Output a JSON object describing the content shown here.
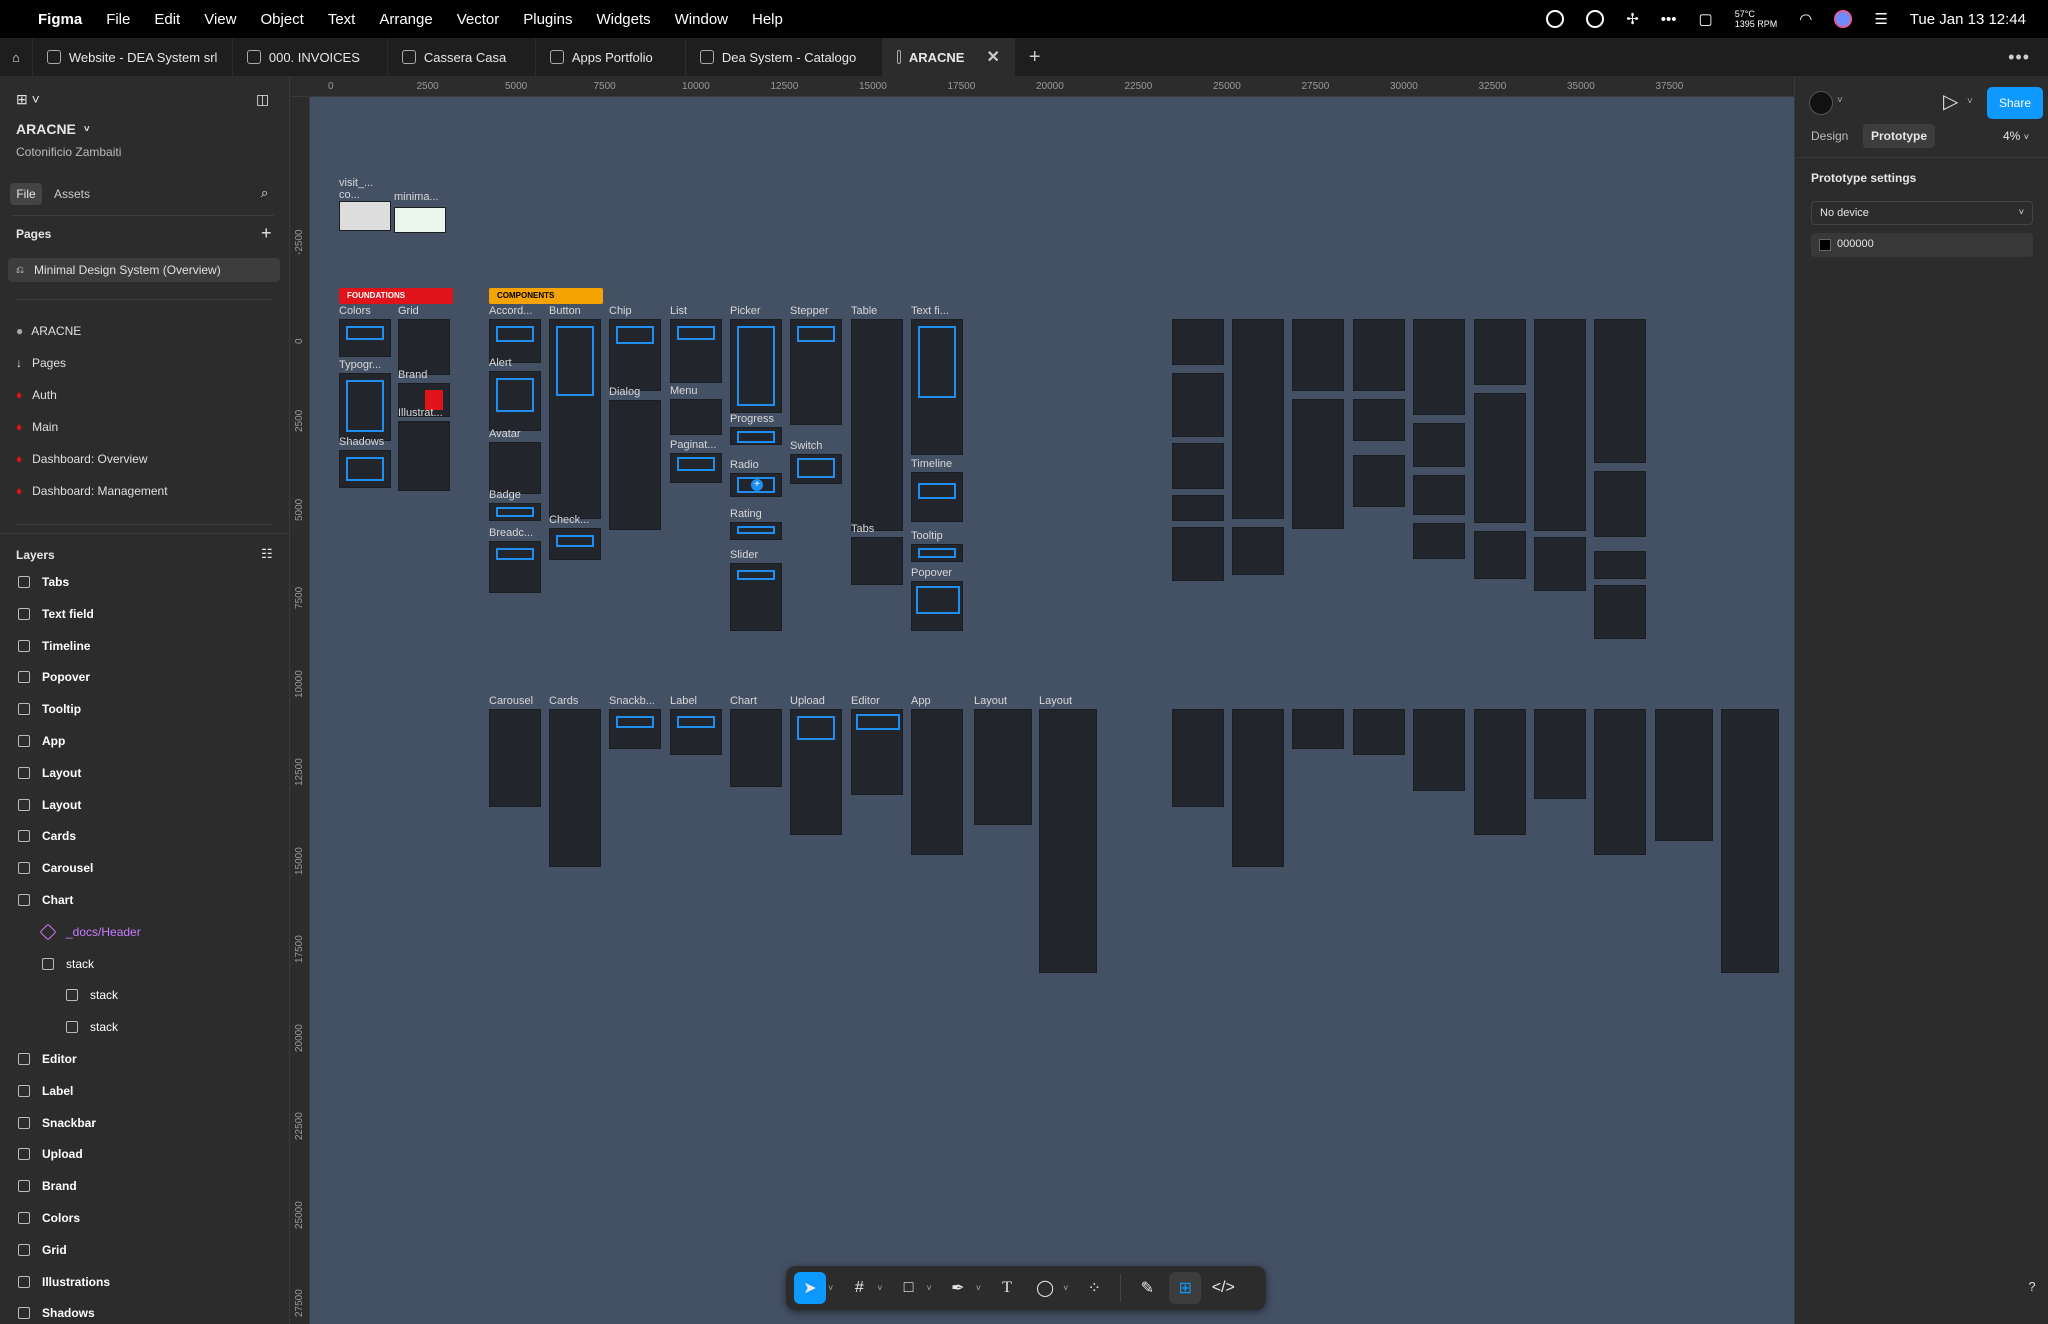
{
  "menubar": {
    "app": "Figma",
    "items": [
      "File",
      "Edit",
      "View",
      "Object",
      "Text",
      "Arrange",
      "Vector",
      "Plugins",
      "Widgets",
      "Window",
      "Help"
    ],
    "temp": "57°C",
    "rpm": "1395 RPM",
    "datetime": "Tue Jan 13  12:44"
  },
  "tabs": [
    {
      "label": "Website - DEA System srl",
      "active": false
    },
    {
      "label": "000. INVOICES",
      "active": false
    },
    {
      "label": "Cassera Casa",
      "active": false
    },
    {
      "label": "Apps Portfolio",
      "active": false
    },
    {
      "label": "Dea System - Catalogo",
      "active": false
    },
    {
      "label": "ARACNE",
      "active": true
    }
  ],
  "left": {
    "file_name": "ARACNE",
    "team": "Cotonificio Zambaiti",
    "tab_file": "File",
    "tab_assets": "Assets",
    "pages_title": "Pages",
    "pages": [
      {
        "label": "Minimal Design System (Overview)",
        "selected": true
      },
      {
        "label": "ARACNE"
      },
      {
        "label": "Pages"
      },
      {
        "label": "Auth"
      },
      {
        "label": "Main"
      },
      {
        "label": "Dashboard: Overview"
      },
      {
        "label": "Dashboard: Management"
      }
    ],
    "layers_title": "Layers",
    "layers": [
      {
        "label": "Tabs",
        "indent": 0
      },
      {
        "label": "Text field",
        "indent": 0
      },
      {
        "label": "Timeline",
        "indent": 0
      },
      {
        "label": "Popover",
        "indent": 0
      },
      {
        "label": "Tooltip",
        "indent": 0
      },
      {
        "label": "App",
        "indent": 0
      },
      {
        "label": "Layout",
        "indent": 0
      },
      {
        "label": "Layout",
        "indent": 0
      },
      {
        "label": "Cards",
        "indent": 0
      },
      {
        "label": "Carousel",
        "indent": 0
      },
      {
        "label": "Chart",
        "indent": 0
      },
      {
        "label": "_docs/Header",
        "indent": 1,
        "component": true
      },
      {
        "label": "stack",
        "indent": 1
      },
      {
        "label": "stack",
        "indent": 2
      },
      {
        "label": "stack",
        "indent": 2
      },
      {
        "label": "Editor",
        "indent": 0
      },
      {
        "label": "Label",
        "indent": 0
      },
      {
        "label": "Snackbar",
        "indent": 0
      },
      {
        "label": "Upload",
        "indent": 0
      },
      {
        "label": "Brand",
        "indent": 0
      },
      {
        "label": "Colors",
        "indent": 0
      },
      {
        "label": "Grid",
        "indent": 0
      },
      {
        "label": "Illustrations",
        "indent": 0
      },
      {
        "label": "Shadows",
        "indent": 0
      }
    ]
  },
  "ruler": {
    "top": [
      "0",
      "2500",
      "5000",
      "7500",
      "10000",
      "12500",
      "15000",
      "17500",
      "20000",
      "22500",
      "25000",
      "27500",
      "30000",
      "32500",
      "35000",
      "37500"
    ],
    "left": [
      "-2500",
      "0",
      "2500",
      "5000",
      "7500",
      "10000",
      "12500",
      "15000",
      "17500",
      "20000",
      "22500",
      "25000",
      "27500"
    ]
  },
  "canvas": {
    "foundations_tag": "FOUNDATIONS",
    "components_tag": "COMPONENTS",
    "labels": {
      "visit": "visit_...",
      "co": "co...",
      "minima": "minima...",
      "colors": "Colors",
      "grid": "Grid",
      "typogr": "Typogr...",
      "brand": "Brand",
      "illustrat": "Illustrat...",
      "shadows": "Shadows",
      "accord": "Accord...",
      "button": "Button",
      "chip": "Chip",
      "list": "List",
      "picker": "Picker",
      "stepper": "Stepper",
      "table": "Table",
      "textfi": "Text fi...",
      "alert": "Alert",
      "dialog": "Dialog",
      "menu": "Menu",
      "progress": "Progress",
      "switch": "Switch",
      "avatar": "Avatar",
      "paginat": "Paginat...",
      "radio": "Radio",
      "timeline": "Timeline",
      "badge": "Badge",
      "rating": "Rating",
      "breadc": "Breadc...",
      "check": "Check...",
      "tabs": "Tabs",
      "tooltip": "Tooltip",
      "slider": "Slider",
      "popover": "Popover",
      "carousel": "Carousel",
      "cards": "Cards",
      "snackb": "Snackb...",
      "label": "Label",
      "chart": "Chart",
      "upload": "Upload",
      "editor": "Editor",
      "app": "App",
      "layout1": "Layout",
      "layout2": "Layout"
    }
  },
  "right": {
    "share": "Share",
    "tab_design": "Design",
    "tab_prototype": "Prototype",
    "zoom": "4%",
    "section_title": "Prototype settings",
    "device": "No device",
    "bg_color": "000000"
  },
  "colors": {
    "accent": "#0d99ff",
    "foundations": "#e0121a",
    "components": "#f5a300",
    "canvas": "#445064"
  }
}
